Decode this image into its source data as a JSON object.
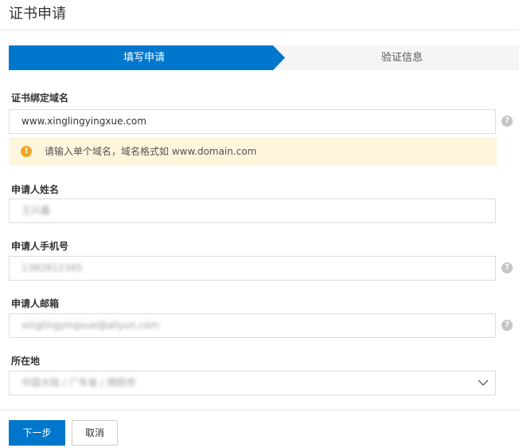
{
  "page": {
    "title": "证书申请"
  },
  "steps": [
    {
      "label": "填写申请",
      "active": true
    },
    {
      "label": "验证信息",
      "active": false
    }
  ],
  "form": {
    "domain": {
      "label": "证书绑定域名",
      "value": "www.xinglingyingxue.com",
      "help_icon": "question-icon"
    },
    "notice": {
      "icon": "warning-icon",
      "text": "请输入单个域名，域名格式如 www.domain.com"
    },
    "name": {
      "label": "申请人姓名",
      "value": "王兴鑫"
    },
    "phone": {
      "label": "申请人手机号",
      "value": "1382812345",
      "help_icon": "question-icon"
    },
    "email": {
      "label": "申请人邮箱",
      "value": "xinglingyingxue@aliyun.com",
      "help_icon": "question-icon"
    },
    "location": {
      "label": "所在地",
      "value": "中国大陆 / 广东省 / 揭阳市"
    }
  },
  "actions": {
    "next_label": "下一步",
    "cancel_label": "取消"
  },
  "colors": {
    "primary": "#0077cc",
    "step_inactive": "#f5f5f5",
    "notice_bg": "#fdf6dc",
    "warning": "#f5a623"
  }
}
